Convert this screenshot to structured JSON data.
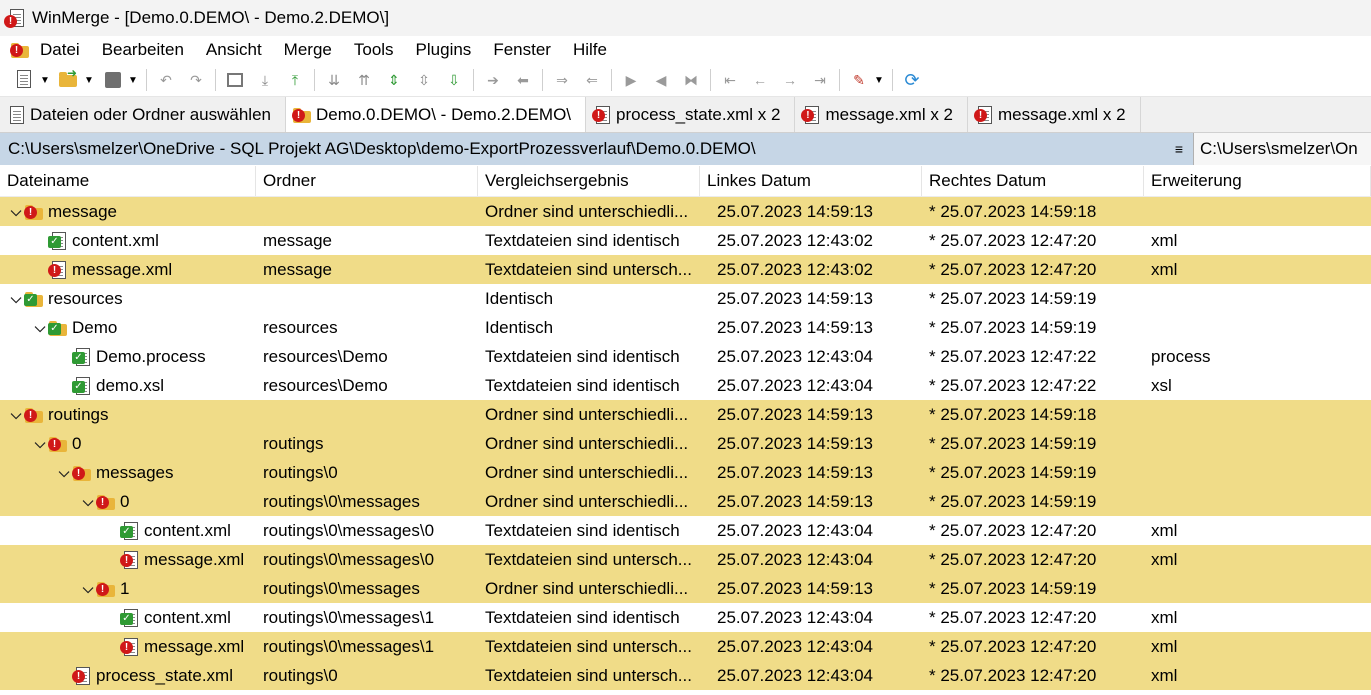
{
  "window": {
    "title": "WinMerge - [Demo.0.DEMO\\ - Demo.2.DEMO\\]"
  },
  "menu": [
    "Datei",
    "Bearbeiten",
    "Ansicht",
    "Merge",
    "Tools",
    "Plugins",
    "Fenster",
    "Hilfe"
  ],
  "tabs": [
    {
      "label": "Dateien oder Ordner auswählen",
      "icon": "open-icon"
    },
    {
      "label": "Demo.0.DEMO\\ - Demo.2.DEMO\\",
      "icon": "folder-diff-icon"
    },
    {
      "label": "process_state.xml x 2",
      "icon": "file-diff-icon"
    },
    {
      "label": "message.xml x 2",
      "icon": "file-diff-icon"
    },
    {
      "label": "message.xml x 2",
      "icon": "file-diff-icon"
    }
  ],
  "paths": {
    "left": "C:\\Users\\smelzer\\OneDrive - SQL Projekt AG\\Desktop\\demo-ExportProzessverlauf\\Demo.0.DEMO\\",
    "menu_icon": "≡",
    "right": "C:\\Users\\smelzer\\On"
  },
  "columns": [
    "Dateiname",
    "Ordner",
    "Vergleichsergebnis",
    "Linkes Datum",
    "Rechtes Datum",
    "Erweiterung"
  ],
  "rows": [
    {
      "level": 0,
      "chev": "down",
      "type": "folder",
      "status": "diff",
      "name": "message",
      "folder": "",
      "result": "Ordner sind unterschiedli...",
      "left": "25.07.2023 14:59:13",
      "right": "* 25.07.2023 14:59:18",
      "ext": ""
    },
    {
      "level": 1,
      "chev": "",
      "type": "file",
      "status": "same",
      "name": "content.xml",
      "folder": "message",
      "result": "Textdateien sind identisch",
      "left": "25.07.2023 12:43:02",
      "right": "* 25.07.2023 12:47:20",
      "ext": "xml"
    },
    {
      "level": 1,
      "chev": "",
      "type": "file",
      "status": "diff",
      "name": "message.xml",
      "folder": "message",
      "result": "Textdateien sind untersch...",
      "left": "25.07.2023 12:43:02",
      "right": "* 25.07.2023 12:47:20",
      "ext": "xml"
    },
    {
      "level": 0,
      "chev": "down",
      "type": "folder",
      "status": "same",
      "name": "resources",
      "folder": "",
      "result": "Identisch",
      "left": "25.07.2023 14:59:13",
      "right": "* 25.07.2023 14:59:19",
      "ext": ""
    },
    {
      "level": 1,
      "chev": "down",
      "type": "folder",
      "status": "same",
      "name": "Demo",
      "folder": "resources",
      "result": "Identisch",
      "left": "25.07.2023 14:59:13",
      "right": "* 25.07.2023 14:59:19",
      "ext": ""
    },
    {
      "level": 2,
      "chev": "",
      "type": "file",
      "status": "same",
      "name": "Demo.process",
      "folder": "resources\\Demo",
      "result": "Textdateien sind identisch",
      "left": "25.07.2023 12:43:04",
      "right": "* 25.07.2023 12:47:22",
      "ext": "process"
    },
    {
      "level": 2,
      "chev": "",
      "type": "file",
      "status": "same",
      "name": "demo.xsl",
      "folder": "resources\\Demo",
      "result": "Textdateien sind identisch",
      "left": "25.07.2023 12:43:04",
      "right": "* 25.07.2023 12:47:22",
      "ext": "xsl"
    },
    {
      "level": 0,
      "chev": "down",
      "type": "folder",
      "status": "diff",
      "name": "routings",
      "folder": "",
      "result": "Ordner sind unterschiedli...",
      "left": "25.07.2023 14:59:13",
      "right": "* 25.07.2023 14:59:18",
      "ext": ""
    },
    {
      "level": 1,
      "chev": "down",
      "type": "folder",
      "status": "diff",
      "name": "0",
      "folder": "routings",
      "result": "Ordner sind unterschiedli...",
      "left": "25.07.2023 14:59:13",
      "right": "* 25.07.2023 14:59:19",
      "ext": ""
    },
    {
      "level": 2,
      "chev": "down",
      "type": "folder",
      "status": "diff",
      "name": "messages",
      "folder": "routings\\0",
      "result": "Ordner sind unterschiedli...",
      "left": "25.07.2023 14:59:13",
      "right": "* 25.07.2023 14:59:19",
      "ext": ""
    },
    {
      "level": 3,
      "chev": "down",
      "type": "folder",
      "status": "diff",
      "name": "0",
      "folder": "routings\\0\\messages",
      "result": "Ordner sind unterschiedli...",
      "left": "25.07.2023 14:59:13",
      "right": "* 25.07.2023 14:59:19",
      "ext": ""
    },
    {
      "level": 4,
      "chev": "",
      "type": "file",
      "status": "same",
      "name": "content.xml",
      "folder": "routings\\0\\messages\\0",
      "result": "Textdateien sind identisch",
      "left": "25.07.2023 12:43:04",
      "right": "* 25.07.2023 12:47:20",
      "ext": "xml"
    },
    {
      "level": 4,
      "chev": "",
      "type": "file",
      "status": "diff",
      "name": "message.xml",
      "folder": "routings\\0\\messages\\0",
      "result": "Textdateien sind untersch...",
      "left": "25.07.2023 12:43:04",
      "right": "* 25.07.2023 12:47:20",
      "ext": "xml"
    },
    {
      "level": 3,
      "chev": "down",
      "type": "folder",
      "status": "diff",
      "name": "1",
      "folder": "routings\\0\\messages",
      "result": "Ordner sind unterschiedli...",
      "left": "25.07.2023 14:59:13",
      "right": "* 25.07.2023 14:59:19",
      "ext": ""
    },
    {
      "level": 4,
      "chev": "",
      "type": "file",
      "status": "same",
      "name": "content.xml",
      "folder": "routings\\0\\messages\\1",
      "result": "Textdateien sind identisch",
      "left": "25.07.2023 12:43:04",
      "right": "* 25.07.2023 12:47:20",
      "ext": "xml"
    },
    {
      "level": 4,
      "chev": "",
      "type": "file",
      "status": "diff",
      "name": "message.xml",
      "folder": "routings\\0\\messages\\1",
      "result": "Textdateien sind untersch...",
      "left": "25.07.2023 12:43:04",
      "right": "* 25.07.2023 12:47:20",
      "ext": "xml"
    },
    {
      "level": 2,
      "chev": "",
      "type": "file",
      "status": "diff",
      "name": "process_state.xml",
      "folder": "routings\\0",
      "result": "Textdateien sind untersch...",
      "left": "25.07.2023 12:43:04",
      "right": "* 25.07.2023 12:47:20",
      "ext": "xml"
    }
  ],
  "colors": {
    "diff_row": "#f0dc88",
    "path_bar": "#c6d6e6",
    "diff_icon": "#d01818",
    "same_icon": "#2f9a34"
  }
}
